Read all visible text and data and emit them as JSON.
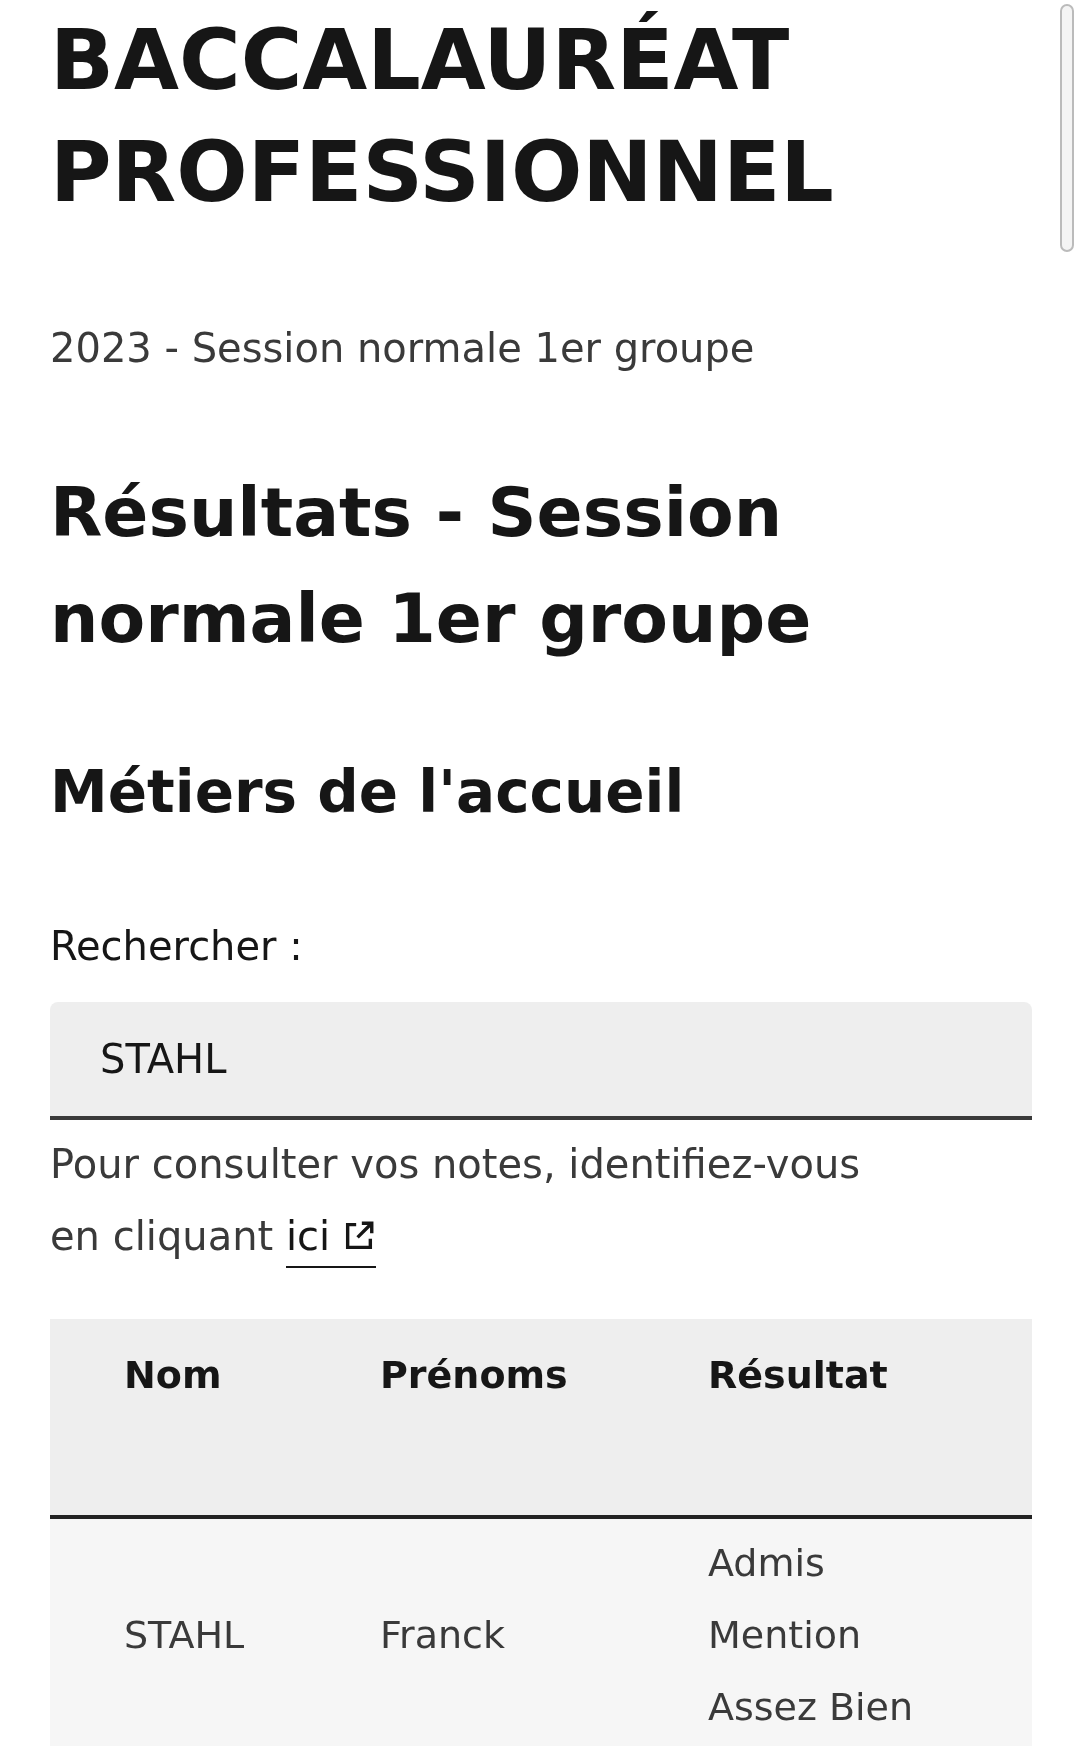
{
  "title": "BACCALAURÉAT PROFESSIONNEL",
  "session": "2023 - Session normale 1er groupe",
  "heading": "Résultats - Session normale 1er groupe",
  "subheading": "Métiers de l'accueil",
  "search": {
    "label": "Rechercher :",
    "value": "STAHL"
  },
  "notice": {
    "text": "Pour consulter vos notes, identifiez-vous en cliquant",
    "link": "ici"
  },
  "table": {
    "columns": [
      "Nom",
      "Prénoms",
      "Résultat"
    ],
    "rows": [
      [
        "STAHL",
        "Franck",
        "Admis Mention Assez Bien"
      ]
    ]
  }
}
